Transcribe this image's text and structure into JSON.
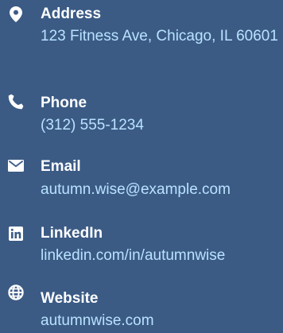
{
  "contacts": [
    {
      "label": "Address",
      "value": "123 Fitness Ave, Chicago, IL 60601",
      "icon": "map-pin-icon"
    },
    {
      "label": "Phone",
      "value": "(312) 555-1234",
      "icon": "phone-icon"
    },
    {
      "label": "Email",
      "value": "autumn.wise@example.com",
      "icon": "envelope-icon"
    },
    {
      "label": "LinkedIn",
      "value": "linkedin.com/in/autumnwise",
      "icon": "linkedin-icon"
    },
    {
      "label": "Website",
      "value": "autumnwise.com",
      "icon": "globe-icon"
    }
  ],
  "colors": {
    "background": "#3b5b85",
    "label": "#ffffff",
    "value": "#b9e2ff"
  }
}
